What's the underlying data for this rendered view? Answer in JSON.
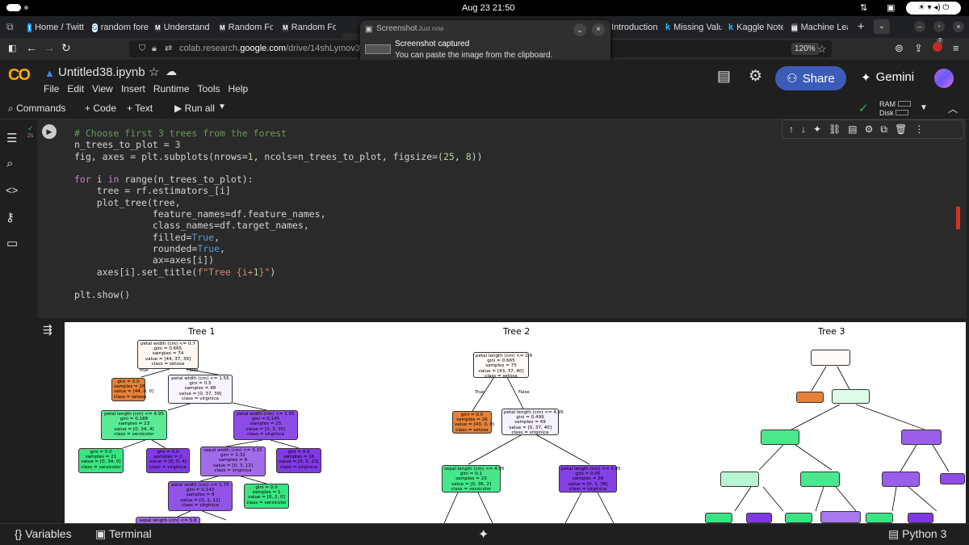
{
  "system": {
    "clock": "Aug 23  21:50"
  },
  "tabs": [
    {
      "label": "Home / Twitt",
      "icon": "twitter-icon"
    },
    {
      "label": "random fore",
      "icon": "google-icon"
    },
    {
      "label": "Understandi",
      "icon": "medium-icon"
    },
    {
      "label": "Random For",
      "icon": "medium-icon"
    },
    {
      "label": "Random For",
      "icon": "medium-icon"
    },
    {
      "label": "Introduction",
      "icon": "page-icon"
    },
    {
      "label": "Missing Valu",
      "icon": "kaggle-icon"
    },
    {
      "label": "Kaggle Note",
      "icon": "kaggle-icon"
    },
    {
      "label": "Machine Lea",
      "icon": "page-icon"
    }
  ],
  "toast": {
    "app": "Screenshot",
    "time": "Just now",
    "title": "Screenshot captured",
    "body": "You can paste the image from the clipboard."
  },
  "browser": {
    "url_prefix": "colab.research.",
    "url_host": "google.com",
    "url_rest": "/drive/14shLymov359Co",
    "zoom": "120%",
    "ext_badge": "7"
  },
  "notebook": {
    "title": "Untitled38.ipynb"
  },
  "menu": [
    "File",
    "Edit",
    "View",
    "Insert",
    "Runtime",
    "Tools",
    "Help"
  ],
  "header": {
    "share": "Share",
    "gemini": "Gemini"
  },
  "toolbar": {
    "commands": "Commands",
    "code": "+ Code",
    "text": "+ Text",
    "run_all": "Run all",
    "ram": "RAM",
    "disk": "Disk"
  },
  "cell": {
    "exec_time": "2s",
    "code_lines": [
      "# Choose first 3 trees from the forest",
      "n_trees_to_plot = 3",
      "fig, axes = plt.subplots(nrows=1, ncols=n_trees_to_plot, figsize=(25, 8))",
      "",
      "for i in range(n_trees_to_plot):",
      "    tree = rf.estimators_[i]",
      "    plot_tree(tree,",
      "              feature_names=df.feature_names,",
      "              class_names=df.target_names,",
      "              filled=True,",
      "              rounded=True,",
      "              ax=axes[i])",
      "    axes[i].set_title(f\"Tree {i+1}\")",
      "",
      "plt.show()"
    ]
  },
  "figure": {
    "titles": [
      "Tree 1",
      "Tree 2",
      "Tree 3"
    ],
    "tree1": [
      [
        "petal width (cm) <= 0.7",
        "gini = 0.665",
        "samples = 74",
        "value = [44, 37, 39]",
        "class = setosa"
      ],
      [
        "gini = 0.0",
        "samples = 26",
        "value = [44, 0, 0]",
        "class = setosa"
      ],
      [
        "petal width (cm) <= 1.55",
        "gini = 0.5",
        "samples = 48",
        "value = [0, 37, 39]",
        "class = virginica"
      ],
      [
        "petal length (cm) <= 4.95",
        "gini = 0.188",
        "samples = 23",
        "value = [0, 34, 4]",
        "class = versicolor"
      ],
      [
        "petal width (cm) <= 1.85",
        "gini = 0.145",
        "samples = 25",
        "value = [0, 3, 35]",
        "class = virginica"
      ],
      [
        "gini = 0.0",
        "samples = 21",
        "value = [0, 34, 0]",
        "class = versicolor"
      ],
      [
        "gini = 0.0",
        "samples = 2",
        "value = [0, 0, 4]",
        "class = virginica"
      ],
      [
        "sepal width (cm) <= 3.15",
        "gini = 0.32",
        "samples = 9",
        "value = [0, 3, 12]",
        "class = virginica"
      ],
      [
        "gini = 0.0",
        "samples = 16",
        "value = [0, 0, 23]",
        "class = virginica"
      ],
      [
        "petal width (cm) <= 1.75",
        "gini = 0.142",
        "samples = 8",
        "value = [0, 1, 12]",
        "class = virginica"
      ],
      [
        "gini = 0.0",
        "samples = 1",
        "value = [0, 2, 0]",
        "class = versicolor"
      ],
      [
        "sepal length (cm) <= 5.8"
      ]
    ],
    "tree2": [
      [
        "petal length (cm) <= 2.6",
        "gini = 0.665",
        "samples = 75",
        "value = [43, 37, 40]",
        "class = setosa"
      ],
      [
        "gini = 0.0",
        "samples = 26",
        "value = [43, 0, 0]",
        "class = setosa"
      ],
      [
        "petal length (cm) <= 4.95",
        "gini = 0.499",
        "samples = 49",
        "value = [0, 37, 40]",
        "class = virginica"
      ],
      [
        "sepal length (cm) <= 4.95",
        "gini = 0.1",
        "samples = 23",
        "value = [0, 36, 2]",
        "class = versicolor"
      ],
      [
        "petal length (cm) <= 5.05",
        "gini = 0.05",
        "samples = 26",
        "value = [0, 1, 38]",
        "class = virginica"
      ]
    ],
    "true_label": "True",
    "false_label": "False"
  },
  "status": {
    "variables": "Variables",
    "terminal": "Terminal",
    "kernel": "Python 3"
  },
  "colors": {
    "setosa": "#e58139",
    "versicolor": "#39e581",
    "virginica": "#8139e5",
    "share": "#3c5cb8"
  }
}
